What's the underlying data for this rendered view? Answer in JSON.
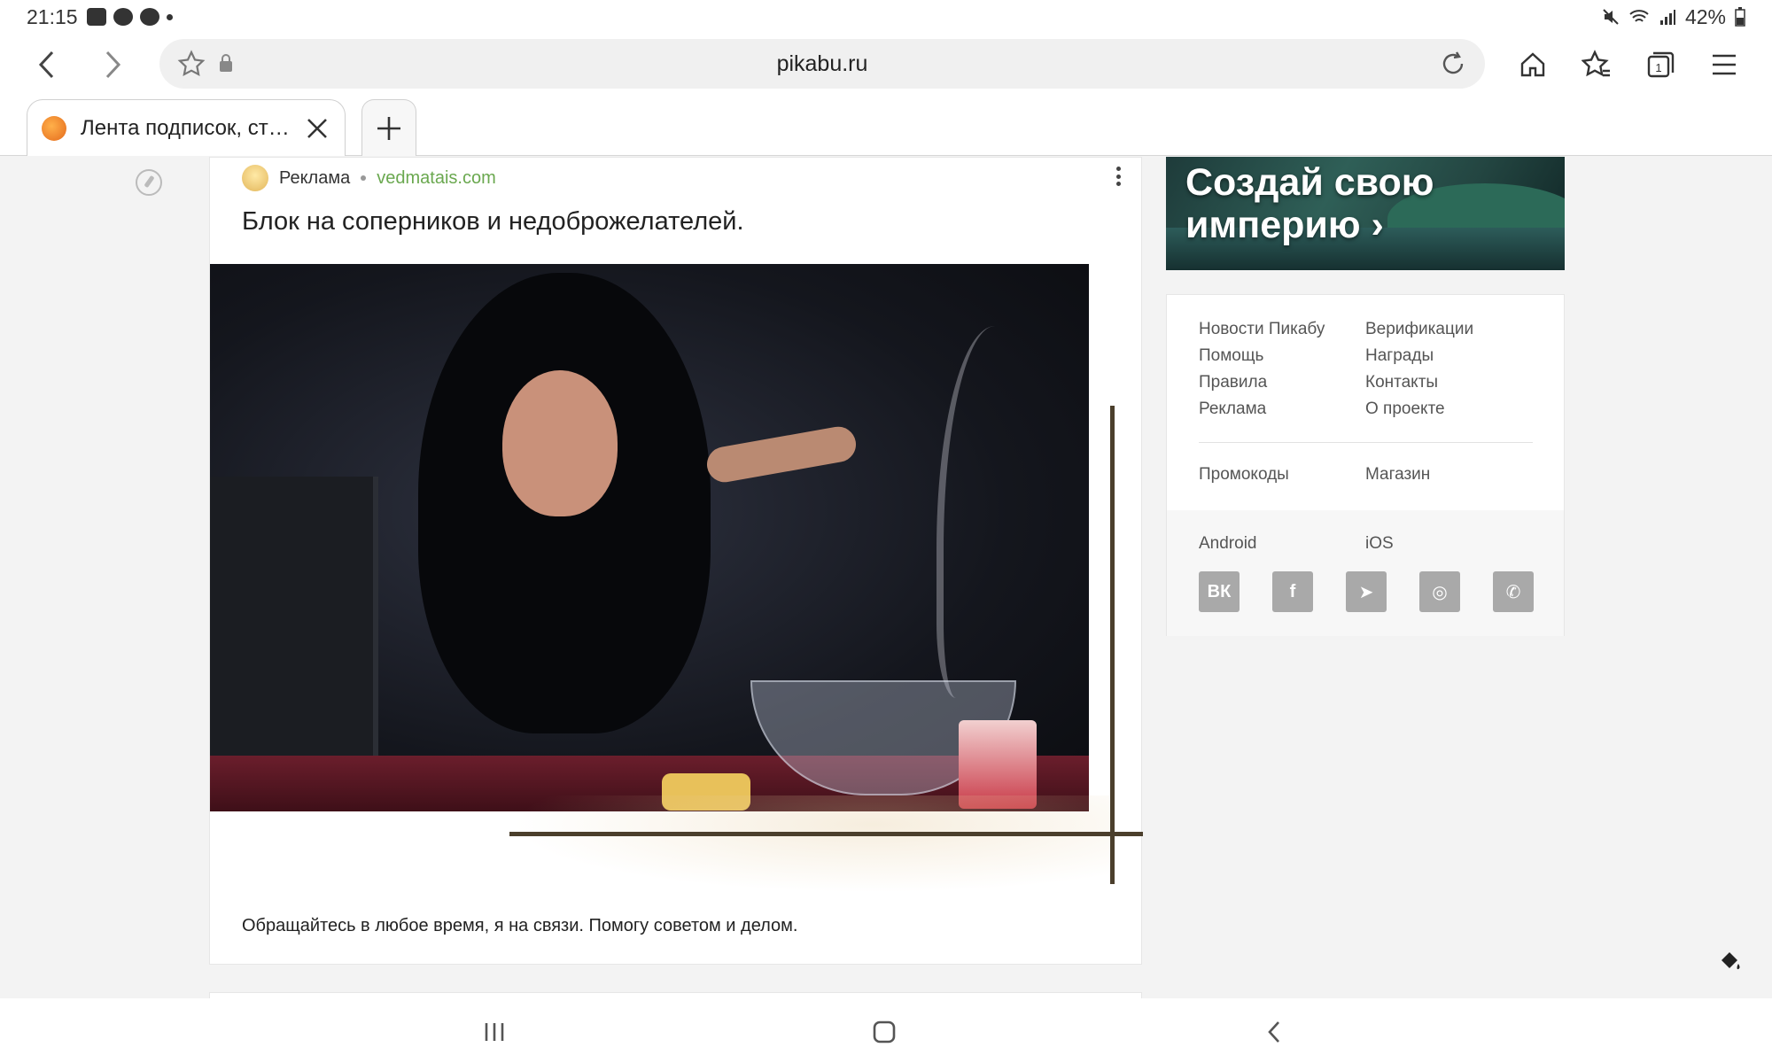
{
  "status_bar": {
    "time": "21:15",
    "battery": "42%",
    "icons": [
      "youtube-icon",
      "cast-icon",
      "account-icon",
      "mute-icon",
      "wifi-icon",
      "signal-icon",
      "battery-icon"
    ]
  },
  "browser": {
    "url": "pikabu.ru",
    "tab_title": "Лента подписок, стр...",
    "toolbar_icons": [
      "back-icon",
      "forward-icon",
      "bookmark-star-icon",
      "lock-icon",
      "reload-icon",
      "home-icon",
      "bookmarks-icon",
      "tabs-icon",
      "menu-icon"
    ],
    "tab_count": "1"
  },
  "post": {
    "ad_label": "Реклама",
    "ad_domain": "vedmatais.com",
    "title": "Блок на соперников и недоброжелателей.",
    "body": "Обращайтесь в любое время, я на связи. Помогу советом и делом."
  },
  "sidebar": {
    "promo_text": "Создай свою империю ›",
    "links": [
      "Новости Пикабу",
      "Верификации",
      "Помощь",
      "Награды",
      "Правила",
      "Контакты",
      "Реклама",
      "О проекте"
    ],
    "links2": [
      "Промокоды",
      "Магазин"
    ],
    "apps": [
      "Android",
      "iOS"
    ],
    "social": [
      {
        "name": "vk",
        "glyph": "ВК"
      },
      {
        "name": "facebook",
        "glyph": "f"
      },
      {
        "name": "telegram",
        "glyph": "➤"
      },
      {
        "name": "instagram",
        "glyph": "◎"
      },
      {
        "name": "viber",
        "glyph": "✆"
      }
    ]
  },
  "colors": {
    "accent_green": "#6aa84f",
    "page_bg": "#f3f3f3"
  }
}
